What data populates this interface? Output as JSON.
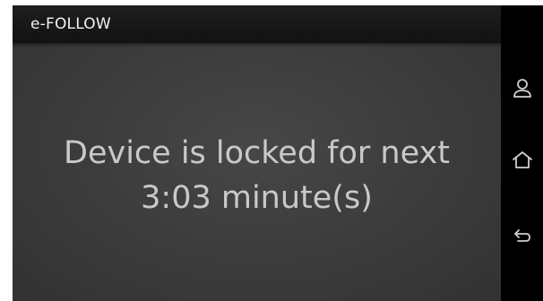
{
  "app_bar": {
    "title": "e-FOLLOW"
  },
  "message": {
    "line1": "Device is locked for next",
    "line2": "3:03 minute(s)"
  },
  "nav_bar": {
    "buttons": [
      {
        "icon": "person-icon"
      },
      {
        "icon": "home-icon"
      },
      {
        "icon": "back-icon"
      }
    ]
  },
  "colors": {
    "app_bar": "#151515",
    "screen_background": "#3b3b3b",
    "message_text": "#c9c9c9",
    "nav_bar": "#000000",
    "nav_icons": "#cfcfcf"
  }
}
